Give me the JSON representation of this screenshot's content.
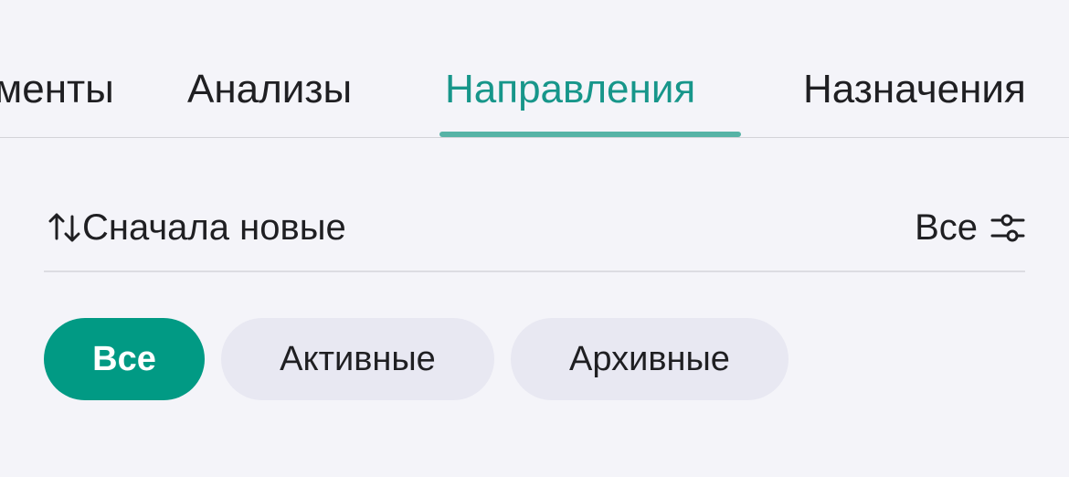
{
  "tabs": [
    {
      "label": "менты",
      "active": false
    },
    {
      "label": "Анализы",
      "active": false
    },
    {
      "label": "Направления",
      "active": true
    },
    {
      "label": "Назначения",
      "active": false
    }
  ],
  "sort": {
    "label": "Сначала новые",
    "icon": "sort-arrows-icon"
  },
  "filter": {
    "label": "Все",
    "icon": "filter-sliders-icon"
  },
  "chips": [
    {
      "label": "Все",
      "active": true
    },
    {
      "label": "Активные",
      "active": false
    },
    {
      "label": "Архивные",
      "active": false
    }
  ],
  "colors": {
    "accent": "#17968a",
    "accent_indicator": "#56b3a6",
    "chip_active_bg": "#019a84",
    "chip_bg": "#e8e8f2",
    "background": "#f4f4f9"
  }
}
